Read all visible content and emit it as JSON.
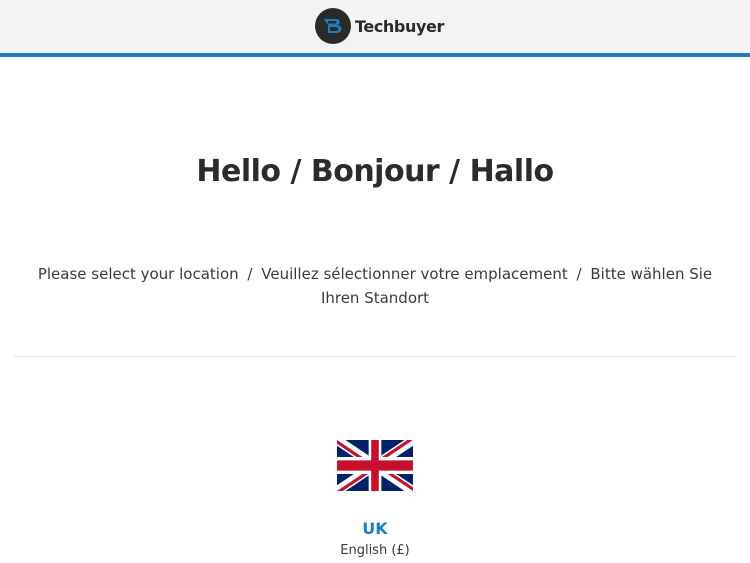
{
  "header": {
    "brand_name": "Techbuyer",
    "accent_color": "#1b7fc2",
    "logo_icon": "techbuyer-logo-icon"
  },
  "main": {
    "title": "Hello / Bonjour / Hallo",
    "subtitle": {
      "english": "Please select your location",
      "separator": "/",
      "french": "Veuillez sélectionner votre emplacement",
      "german": "Bitte wählen Sie Ihren Standort"
    }
  },
  "locations": [
    {
      "name": "UK",
      "language": "English (£)",
      "flag_icon": "uk-flag-icon"
    }
  ]
}
